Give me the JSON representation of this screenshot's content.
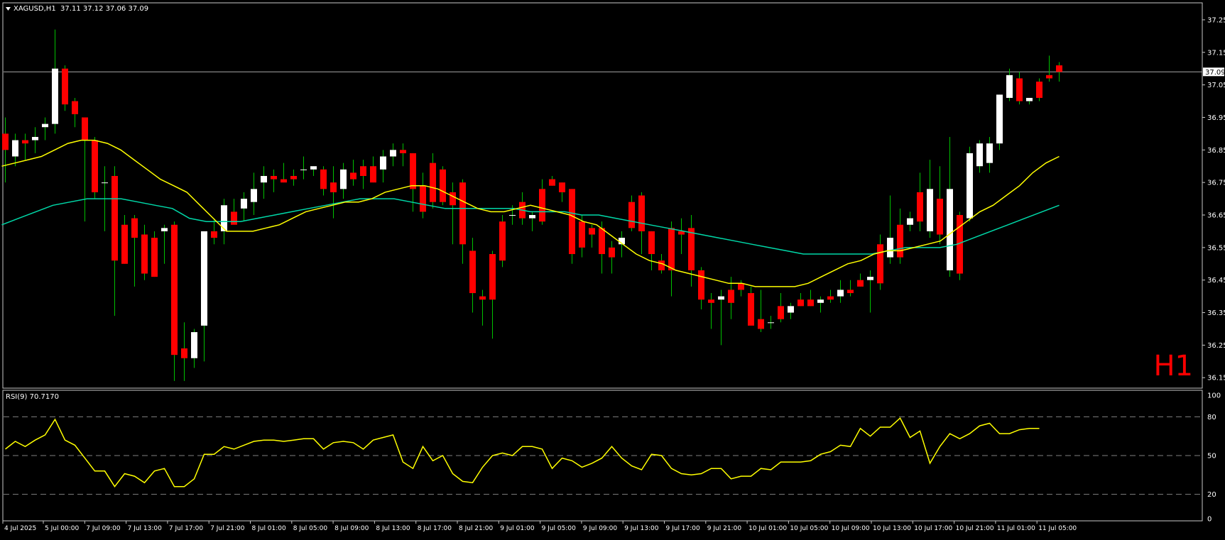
{
  "header": {
    "symbol_line": "XAGUSD,H1  37.11 37.12 37.06 37.09"
  },
  "watermark": "H1",
  "colors": {
    "background": "#000000",
    "frame": "#c8c8c8",
    "bull_candle": "#ffffff",
    "bear_candle": "#ff0000",
    "wick": "#00c000",
    "ma_fast": "#ffff00",
    "ma_slow": "#00d8a8",
    "rsi_line": "#ffff00",
    "level_line": "#808080",
    "text": "#ffffff",
    "watermark": "#ff0000"
  },
  "chart_data": [
    {
      "type": "candlestick",
      "symbol": "XAGUSD",
      "timeframe": "H1",
      "current_price_label": "37.09",
      "current_price": 37.09,
      "ylim": [
        36.12,
        37.3
      ],
      "y_ticks": [
        "37.25",
        "37.15",
        "37.05",
        "36.95",
        "36.85",
        "36.75",
        "36.65",
        "36.55",
        "36.45",
        "36.35",
        "36.25",
        "36.15"
      ],
      "x_tick_labels": [
        "4 Jul 2025",
        "5 Jul 00:00",
        "7 Jul 09:00",
        "7 Jul 13:00",
        "7 Jul 17:00",
        "7 Jul 21:00",
        "8 Jul 01:00",
        "8 Jul 05:00",
        "8 Jul 09:00",
        "8 Jul 13:00",
        "8 Jul 17:00",
        "8 Jul 21:00",
        "9 Jul 01:00",
        "9 Jul 05:00",
        "9 Jul 09:00",
        "9 Jul 13:00",
        "9 Jul 17:00",
        "9 Jul 21:00",
        "10 Jul 01:00",
        "10 Jul 05:00",
        "10 Jul 09:00",
        "10 Jul 13:00",
        "10 Jul 17:00",
        "10 Jul 21:00",
        "11 Jul 01:00",
        "11 Jul 05:00"
      ],
      "candles": [
        {
          "o": 36.9,
          "h": 36.95,
          "l": 36.75,
          "c": 36.85
        },
        {
          "o": 36.83,
          "h": 36.9,
          "l": 36.8,
          "c": 36.88
        },
        {
          "o": 36.88,
          "h": 36.9,
          "l": 36.82,
          "c": 36.87
        },
        {
          "o": 36.88,
          "h": 36.92,
          "l": 36.84,
          "c": 36.89
        },
        {
          "o": 36.92,
          "h": 36.95,
          "l": 36.88,
          "c": 36.93
        },
        {
          "o": 36.93,
          "h": 37.22,
          "l": 36.9,
          "c": 37.1
        },
        {
          "o": 37.1,
          "h": 37.11,
          "l": 36.97,
          "c": 36.99
        },
        {
          "o": 37.0,
          "h": 37.01,
          "l": 36.92,
          "c": 36.96
        },
        {
          "o": 36.95,
          "h": 36.95,
          "l": 36.63,
          "c": 36.88
        },
        {
          "o": 36.88,
          "h": 36.89,
          "l": 36.7,
          "c": 36.72
        },
        {
          "o": 36.75,
          "h": 36.8,
          "l": 36.6,
          "c": 36.75
        },
        {
          "o": 36.77,
          "h": 36.8,
          "l": 36.34,
          "c": 36.51
        },
        {
          "o": 36.62,
          "h": 36.65,
          "l": 36.5,
          "c": 36.5
        },
        {
          "o": 36.64,
          "h": 36.65,
          "l": 36.43,
          "c": 36.58
        },
        {
          "o": 36.59,
          "h": 36.62,
          "l": 36.45,
          "c": 36.47
        },
        {
          "o": 36.58,
          "h": 36.6,
          "l": 36.46,
          "c": 36.46
        },
        {
          "o": 36.6,
          "h": 36.62,
          "l": 36.5,
          "c": 36.61
        },
        {
          "o": 36.62,
          "h": 36.63,
          "l": 36.14,
          "c": 36.22
        },
        {
          "o": 36.24,
          "h": 36.32,
          "l": 36.14,
          "c": 36.21
        },
        {
          "o": 36.21,
          "h": 36.3,
          "l": 36.18,
          "c": 36.29
        },
        {
          "o": 36.31,
          "h": 36.6,
          "l": 36.2,
          "c": 36.6
        },
        {
          "o": 36.6,
          "h": 36.64,
          "l": 36.56,
          "c": 36.58
        },
        {
          "o": 36.6,
          "h": 36.7,
          "l": 36.56,
          "c": 36.68
        },
        {
          "o": 36.66,
          "h": 36.7,
          "l": 36.63,
          "c": 36.62
        },
        {
          "o": 36.67,
          "h": 36.72,
          "l": 36.63,
          "c": 36.7
        },
        {
          "o": 36.69,
          "h": 36.78,
          "l": 36.65,
          "c": 36.73
        },
        {
          "o": 36.75,
          "h": 36.8,
          "l": 36.7,
          "c": 36.77
        },
        {
          "o": 36.77,
          "h": 36.79,
          "l": 36.72,
          "c": 36.76
        },
        {
          "o": 36.76,
          "h": 36.81,
          "l": 36.75,
          "c": 36.75
        },
        {
          "o": 36.77,
          "h": 36.79,
          "l": 36.74,
          "c": 36.76
        },
        {
          "o": 36.79,
          "h": 36.83,
          "l": 36.76,
          "c": 36.79
        },
        {
          "o": 36.79,
          "h": 36.8,
          "l": 36.77,
          "c": 36.8
        },
        {
          "o": 36.79,
          "h": 36.8,
          "l": 36.71,
          "c": 36.73
        },
        {
          "o": 36.75,
          "h": 36.8,
          "l": 36.64,
          "c": 36.72
        },
        {
          "o": 36.73,
          "h": 36.81,
          "l": 36.7,
          "c": 36.79
        },
        {
          "o": 36.78,
          "h": 36.82,
          "l": 36.74,
          "c": 36.76
        },
        {
          "o": 36.8,
          "h": 36.82,
          "l": 36.73,
          "c": 36.77
        },
        {
          "o": 36.8,
          "h": 36.83,
          "l": 36.75,
          "c": 36.75
        },
        {
          "o": 36.79,
          "h": 36.85,
          "l": 36.75,
          "c": 36.83
        },
        {
          "o": 36.83,
          "h": 36.87,
          "l": 36.8,
          "c": 36.85
        },
        {
          "o": 36.85,
          "h": 36.87,
          "l": 36.8,
          "c": 36.84
        },
        {
          "o": 36.84,
          "h": 36.84,
          "l": 36.66,
          "c": 36.73
        },
        {
          "o": 36.74,
          "h": 36.78,
          "l": 36.64,
          "c": 36.66
        },
        {
          "o": 36.81,
          "h": 36.84,
          "l": 36.67,
          "c": 36.69
        },
        {
          "o": 36.79,
          "h": 36.8,
          "l": 36.68,
          "c": 36.69
        },
        {
          "o": 36.72,
          "h": 36.75,
          "l": 36.56,
          "c": 36.68
        },
        {
          "o": 36.75,
          "h": 36.76,
          "l": 36.5,
          "c": 36.56
        },
        {
          "o": 36.54,
          "h": 36.58,
          "l": 36.35,
          "c": 36.41
        },
        {
          "o": 36.4,
          "h": 36.42,
          "l": 36.31,
          "c": 36.39
        },
        {
          "o": 36.53,
          "h": 36.54,
          "l": 36.27,
          "c": 36.39
        },
        {
          "o": 36.63,
          "h": 36.65,
          "l": 36.49,
          "c": 36.51
        },
        {
          "o": 36.65,
          "h": 36.68,
          "l": 36.62,
          "c": 36.65
        },
        {
          "o": 36.69,
          "h": 36.72,
          "l": 36.62,
          "c": 36.64
        },
        {
          "o": 36.64,
          "h": 36.66,
          "l": 36.6,
          "c": 36.65
        },
        {
          "o": 36.73,
          "h": 36.76,
          "l": 36.62,
          "c": 36.63
        },
        {
          "o": 36.76,
          "h": 36.77,
          "l": 36.74,
          "c": 36.74
        },
        {
          "o": 36.75,
          "h": 36.75,
          "l": 36.69,
          "c": 36.72
        },
        {
          "o": 36.73,
          "h": 36.73,
          "l": 36.5,
          "c": 36.53
        },
        {
          "o": 36.63,
          "h": 36.65,
          "l": 36.52,
          "c": 36.55
        },
        {
          "o": 36.61,
          "h": 36.62,
          "l": 36.55,
          "c": 36.59
        },
        {
          "o": 36.61,
          "h": 36.63,
          "l": 36.47,
          "c": 36.53
        },
        {
          "o": 36.55,
          "h": 36.57,
          "l": 36.47,
          "c": 36.52
        },
        {
          "o": 36.56,
          "h": 36.6,
          "l": 36.52,
          "c": 36.58
        },
        {
          "o": 36.69,
          "h": 36.71,
          "l": 36.6,
          "c": 36.61
        },
        {
          "o": 36.71,
          "h": 36.72,
          "l": 36.53,
          "c": 36.6
        },
        {
          "o": 36.6,
          "h": 36.6,
          "l": 36.48,
          "c": 36.53
        },
        {
          "o": 36.51,
          "h": 36.53,
          "l": 36.47,
          "c": 36.48
        },
        {
          "o": 36.61,
          "h": 36.63,
          "l": 36.4,
          "c": 36.48
        },
        {
          "o": 36.6,
          "h": 36.64,
          "l": 36.53,
          "c": 36.59
        },
        {
          "o": 36.61,
          "h": 36.65,
          "l": 36.43,
          "c": 36.48
        },
        {
          "o": 36.48,
          "h": 36.49,
          "l": 36.36,
          "c": 36.39
        },
        {
          "o": 36.39,
          "h": 36.41,
          "l": 36.3,
          "c": 36.38
        },
        {
          "o": 36.39,
          "h": 36.42,
          "l": 36.25,
          "c": 36.4
        },
        {
          "o": 36.42,
          "h": 36.46,
          "l": 36.33,
          "c": 36.38
        },
        {
          "o": 36.44,
          "h": 36.45,
          "l": 36.4,
          "c": 36.42
        },
        {
          "o": 36.41,
          "h": 36.43,
          "l": 36.33,
          "c": 36.31
        },
        {
          "o": 36.33,
          "h": 36.42,
          "l": 36.29,
          "c": 36.3
        },
        {
          "o": 36.32,
          "h": 36.34,
          "l": 36.3,
          "c": 36.32
        },
        {
          "o": 36.37,
          "h": 36.41,
          "l": 36.32,
          "c": 36.33
        },
        {
          "o": 36.35,
          "h": 36.38,
          "l": 36.33,
          "c": 36.37
        },
        {
          "o": 36.39,
          "h": 36.41,
          "l": 36.37,
          "c": 36.37
        },
        {
          "o": 36.39,
          "h": 36.42,
          "l": 36.37,
          "c": 36.37
        },
        {
          "o": 36.38,
          "h": 36.4,
          "l": 36.35,
          "c": 36.39
        },
        {
          "o": 36.4,
          "h": 36.42,
          "l": 36.38,
          "c": 36.39
        },
        {
          "o": 36.4,
          "h": 36.45,
          "l": 36.38,
          "c": 36.42
        },
        {
          "o": 36.42,
          "h": 36.45,
          "l": 36.4,
          "c": 36.41
        },
        {
          "o": 36.45,
          "h": 36.47,
          "l": 36.43,
          "c": 36.43
        },
        {
          "o": 36.45,
          "h": 36.48,
          "l": 36.35,
          "c": 36.46
        },
        {
          "o": 36.56,
          "h": 36.59,
          "l": 36.42,
          "c": 36.44
        },
        {
          "o": 36.52,
          "h": 36.71,
          "l": 36.5,
          "c": 36.58
        },
        {
          "o": 36.62,
          "h": 36.67,
          "l": 36.5,
          "c": 36.52
        },
        {
          "o": 36.62,
          "h": 36.66,
          "l": 36.6,
          "c": 36.64
        },
        {
          "o": 36.72,
          "h": 36.78,
          "l": 36.6,
          "c": 36.63
        },
        {
          "o": 36.6,
          "h": 36.82,
          "l": 36.58,
          "c": 36.73
        },
        {
          "o": 36.7,
          "h": 36.8,
          "l": 36.56,
          "c": 36.59
        },
        {
          "o": 36.48,
          "h": 36.89,
          "l": 36.46,
          "c": 36.73
        },
        {
          "o": 36.65,
          "h": 36.66,
          "l": 36.45,
          "c": 36.47
        },
        {
          "o": 36.64,
          "h": 36.86,
          "l": 36.63,
          "c": 36.84
        },
        {
          "o": 36.8,
          "h": 36.88,
          "l": 36.78,
          "c": 36.87
        },
        {
          "o": 36.81,
          "h": 36.89,
          "l": 36.78,
          "c": 36.87
        },
        {
          "o": 36.87,
          "h": 37.02,
          "l": 36.85,
          "c": 37.02
        },
        {
          "o": 37.01,
          "h": 37.1,
          "l": 37.0,
          "c": 37.08
        },
        {
          "o": 37.07,
          "h": 37.09,
          "l": 36.99,
          "c": 37.0
        },
        {
          "o": 37.0,
          "h": 37.01,
          "l": 36.99,
          "c": 37.01
        },
        {
          "o": 37.06,
          "h": 37.07,
          "l": 37.0,
          "c": 37.01
        },
        {
          "o": 37.08,
          "h": 37.14,
          "l": 37.06,
          "c": 37.07
        },
        {
          "o": 37.11,
          "h": 37.12,
          "l": 37.06,
          "c": 37.09
        }
      ],
      "ma_fast": [
        36.8,
        36.81,
        36.82,
        36.83,
        36.85,
        36.87,
        36.88,
        36.88,
        36.87,
        36.85,
        36.82,
        36.79,
        36.76,
        36.74,
        36.72,
        36.68,
        36.64,
        36.6,
        36.6,
        36.6,
        36.61,
        36.62,
        36.64,
        36.66,
        36.67,
        36.68,
        36.69,
        36.69,
        36.7,
        36.72,
        36.73,
        36.74,
        36.74,
        36.73,
        36.71,
        36.69,
        36.67,
        36.66,
        36.66,
        36.67,
        36.68,
        36.67,
        36.66,
        36.65,
        36.63,
        36.62,
        36.59,
        36.56,
        36.53,
        36.51,
        36.5,
        36.48,
        36.47,
        36.46,
        36.45,
        36.44,
        36.44,
        36.43,
        36.43,
        36.43,
        36.43,
        36.44,
        36.46,
        36.48,
        36.5,
        36.51,
        36.53,
        36.54,
        36.54,
        36.55,
        36.56,
        36.57,
        36.6,
        36.63,
        36.66,
        36.68,
        36.71,
        36.74,
        36.78,
        36.81,
        36.83
      ],
      "ma_slow": [
        36.62,
        36.64,
        36.66,
        36.68,
        36.69,
        36.7,
        36.7,
        36.7,
        36.69,
        36.68,
        36.67,
        36.64,
        36.63,
        36.63,
        36.63,
        36.64,
        36.65,
        36.66,
        36.67,
        36.68,
        36.69,
        36.7,
        36.7,
        36.7,
        36.69,
        36.68,
        36.67,
        36.67,
        36.67,
        36.67,
        36.67,
        36.66,
        36.66,
        36.66,
        36.65,
        36.65,
        36.64,
        36.63,
        36.62,
        36.61,
        36.6,
        36.59,
        36.58,
        36.57,
        36.56,
        36.55,
        36.54,
        36.53,
        36.53,
        36.53,
        36.53,
        36.53,
        36.54,
        36.55,
        36.55,
        36.55,
        36.56,
        36.58,
        36.6,
        36.62,
        36.64,
        36.66,
        36.68
      ]
    },
    {
      "type": "line",
      "indicator": "RSI",
      "label": "RSI(9) 70.7170",
      "ylim": [
        0,
        100
      ],
      "y_ticks": [
        "100",
        "80",
        "50",
        "20",
        "0"
      ],
      "levels": [
        80,
        50,
        20
      ],
      "values": [
        55,
        61,
        57,
        62,
        66,
        78,
        62,
        58,
        48,
        38,
        38,
        26,
        36,
        34,
        29,
        38,
        40,
        26,
        26,
        32,
        51,
        51,
        57,
        55,
        58,
        61,
        62,
        62,
        61,
        62,
        63,
        63,
        55,
        60,
        61,
        60,
        55,
        62,
        64,
        66,
        45,
        40,
        57,
        46,
        50,
        36,
        30,
        29,
        41,
        50,
        52,
        50,
        57,
        57,
        55,
        40,
        48,
        46,
        41,
        44,
        48,
        57,
        48,
        42,
        39,
        51,
        50,
        40,
        36,
        35,
        36,
        40,
        40,
        32,
        34,
        34,
        40,
        39,
        45,
        45,
        45,
        46,
        51,
        53,
        58,
        57,
        71,
        65,
        72,
        72,
        79,
        64,
        69,
        44,
        57,
        67,
        63,
        67,
        73,
        75,
        67,
        67,
        70,
        71,
        71
      ]
    }
  ]
}
